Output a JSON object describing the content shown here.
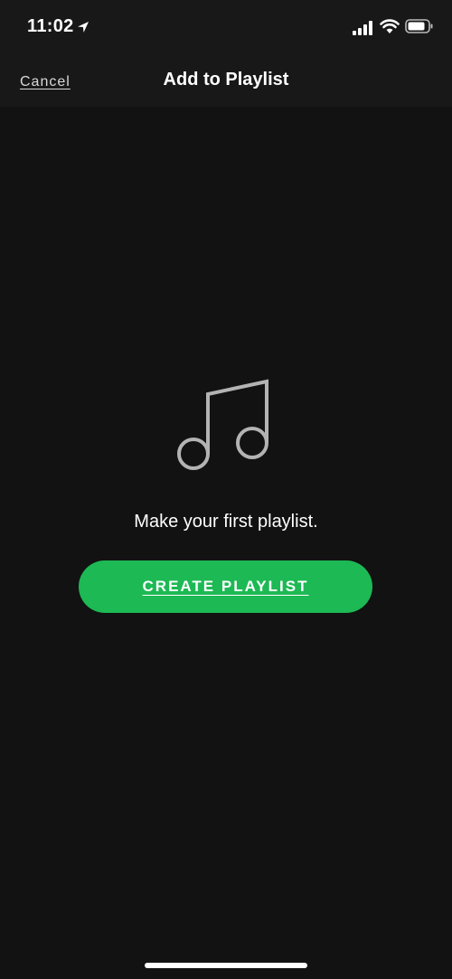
{
  "status_bar": {
    "time": "11:02",
    "icons": [
      "location-arrow-icon",
      "cellular-signal-icon",
      "wifi-icon",
      "battery-icon"
    ]
  },
  "nav": {
    "cancel_label": "Cancel",
    "title": "Add to Playlist"
  },
  "empty_state": {
    "icon": "music-note-icon",
    "message": "Make your first playlist.",
    "create_button_label": "CREATE PLAYLIST"
  },
  "colors": {
    "background": "#121212",
    "header_background": "#181818",
    "accent_green": "#1db954",
    "icon_gray": "#b3b3b3",
    "text_white": "#ffffff"
  }
}
